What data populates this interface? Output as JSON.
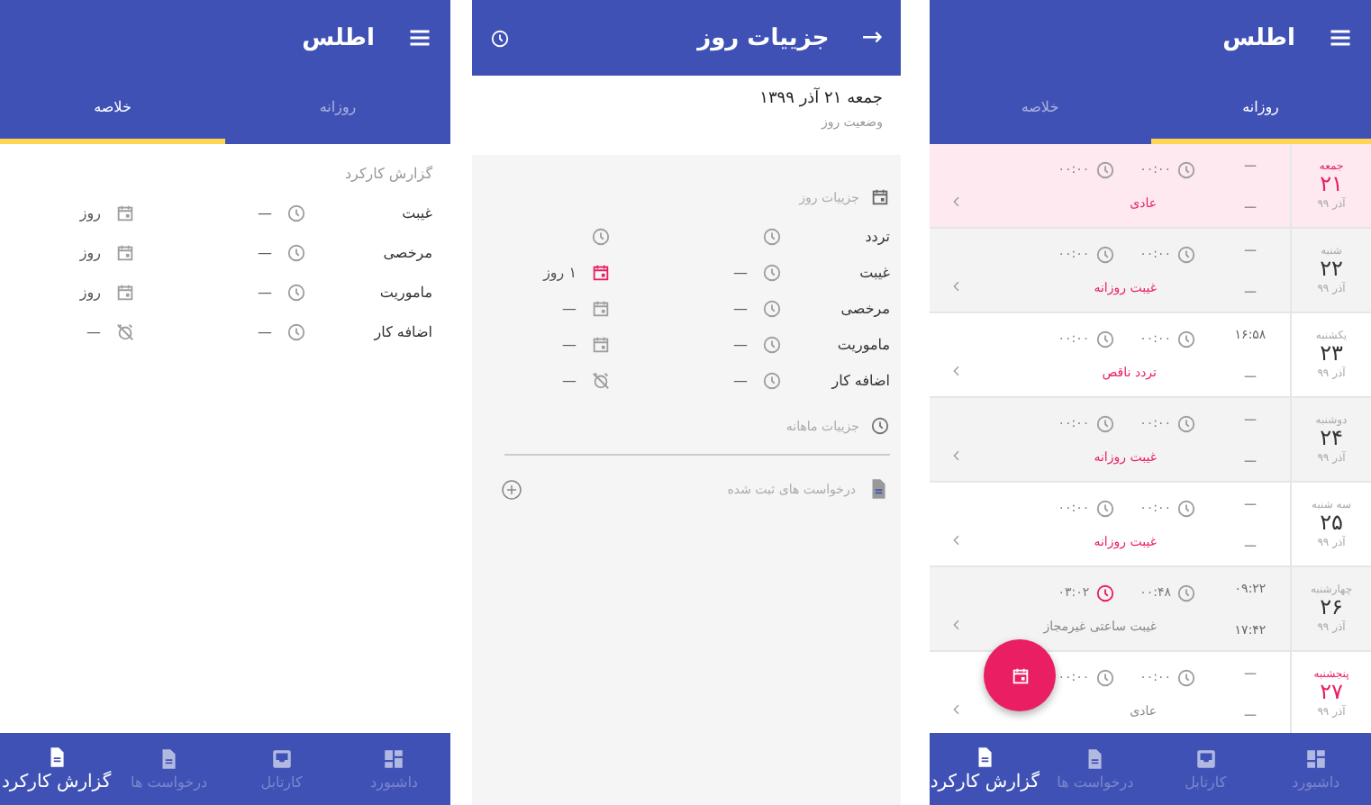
{
  "summary_screen": {
    "title": "اطلس",
    "tabs": [
      {
        "label": "روزانه",
        "selected": false
      },
      {
        "label": "خلاصه",
        "selected": true
      }
    ],
    "section_title": "گزارش کارکرد",
    "rows": [
      {
        "label": "غیبت",
        "hours": "—",
        "days": "روز",
        "kind": "leave"
      },
      {
        "label": "مرخصی",
        "hours": "—",
        "days": "روز",
        "kind": "leave"
      },
      {
        "label": "ماموریت",
        "hours": "—",
        "days": "روز",
        "kind": "leave"
      },
      {
        "label": "اضافه کار",
        "hours": "—",
        "days": "—",
        "kind": "overtime"
      }
    ],
    "bottom_nav": [
      {
        "label": "داشبورد",
        "kind": "dashboard",
        "selected": false
      },
      {
        "label": "کارتابل",
        "kind": "inbox",
        "selected": false
      },
      {
        "label": "درخواست ها",
        "kind": "document",
        "selected": false
      },
      {
        "label": "گزارش کارکرد",
        "kind": "report",
        "selected": true
      }
    ]
  },
  "day_screen": {
    "back_icon": "→",
    "title": "جزییات روز",
    "date": "جمعه ۲۱ آذر ۱۳۹۹",
    "status_label": "وضعیت روز",
    "section_title": "جزییات روز",
    "rows": [
      {
        "label": "تردد",
        "kind": "traffic",
        "highlight": false
      },
      {
        "label": "غیبت",
        "hours": "—",
        "days": "۱ روز",
        "kind": "leave",
        "highlight": true
      },
      {
        "label": "مرخصی",
        "hours": "—",
        "days": "—",
        "kind": "leave",
        "highlight": false
      },
      {
        "label": "ماموریت",
        "hours": "—",
        "days": "—",
        "kind": "leave",
        "highlight": false
      },
      {
        "label": "اضافه کار",
        "hours": "—",
        "days": "—",
        "kind": "overtime",
        "highlight": false
      }
    ],
    "monthly_label": "جزییات ماهانه",
    "requests_label": "درخواست های ثبت شده"
  },
  "daily_screen": {
    "title": "اطلس",
    "tabs": [
      {
        "label": "روزانه",
        "selected": true
      },
      {
        "label": "خلاصه",
        "selected": false
      }
    ],
    "days": [
      {
        "weekday": "جمعه",
        "day": "۲۱",
        "month": "آذر ۹۹",
        "holiday": true,
        "kind": "highlighted",
        "first": "—",
        "second": "—",
        "times": [
          {
            "value": "۰۰:۰۰",
            "alert": false
          },
          {
            "value": "۰۰:۰۰",
            "alert": false
          }
        ],
        "status": "عادی",
        "status_alert": true
      },
      {
        "weekday": "شنبه",
        "day": "۲۲",
        "month": "آذر ۹۹",
        "holiday": false,
        "kind": "shaded",
        "first": "—",
        "second": "—",
        "times": [
          {
            "value": "۰۰:۰۰",
            "alert": false
          },
          {
            "value": "۰۰:۰۰",
            "alert": false
          }
        ],
        "status": "غیبت روزانه",
        "status_alert": true
      },
      {
        "weekday": "یکشنبه",
        "day": "۲۳",
        "month": "آذر ۹۹",
        "holiday": false,
        "kind": "plain",
        "first": "۱۶:۵۸",
        "second": "—",
        "times": [
          {
            "value": "۰۰:۰۰",
            "alert": false
          },
          {
            "value": "۰۰:۰۰",
            "alert": false
          }
        ],
        "status": "تردد ناقص",
        "status_alert": true
      },
      {
        "weekday": "دوشنبه",
        "day": "۲۴",
        "month": "آذر ۹۹",
        "holiday": false,
        "kind": "shaded",
        "first": "—",
        "second": "—",
        "times": [
          {
            "value": "۰۰:۰۰",
            "alert": false
          },
          {
            "value": "۰۰:۰۰",
            "alert": false
          }
        ],
        "status": "غیبت روزانه",
        "status_alert": true
      },
      {
        "weekday": "سه شنبه",
        "day": "۲۵",
        "month": "آذر ۹۹",
        "holiday": false,
        "kind": "plain",
        "first": "—",
        "second": "—",
        "times": [
          {
            "value": "۰۰:۰۰",
            "alert": false
          },
          {
            "value": "۰۰:۰۰",
            "alert": false
          }
        ],
        "status": "غیبت روزانه",
        "status_alert": true
      },
      {
        "weekday": "چهارشنبه",
        "day": "۲۶",
        "month": "آذر ۹۹",
        "holiday": false,
        "kind": "shaded",
        "first": "۰۹:۲۲",
        "second": "۱۷:۴۲",
        "times": [
          {
            "value": "۰۰:۴۸",
            "alert": false
          },
          {
            "value": "۰۳:۰۲",
            "alert": true
          }
        ],
        "status": "غیبت ساعتی غیرمجاز",
        "status_alert": false
      },
      {
        "weekday": "پنجشنبه",
        "day": "۲۷",
        "month": "آذر ۹۹",
        "holiday": true,
        "kind": "plain",
        "first": "—",
        "second": "—",
        "times": [
          {
            "value": "۰۰:۰۰",
            "alert": false
          },
          {
            "value": "۰۰:۰۰",
            "alert": false
          }
        ],
        "status": "عادی",
        "status_alert": false
      }
    ],
    "bottom_nav": [
      {
        "label": "داشبورد",
        "kind": "dashboard",
        "selected": false
      },
      {
        "label": "کارتابل",
        "kind": "inbox",
        "selected": false
      },
      {
        "label": "درخواست ها",
        "kind": "document",
        "selected": false
      },
      {
        "label": "گزارش کارکرد",
        "kind": "report",
        "selected": true
      }
    ]
  }
}
